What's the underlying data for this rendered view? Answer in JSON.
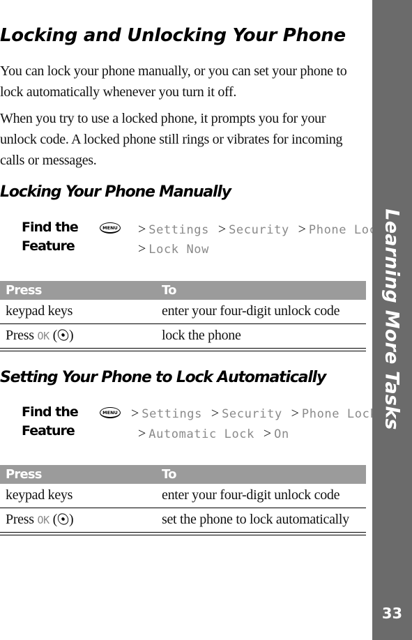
{
  "sidebar": {
    "section_title": "Learning More Tasks",
    "page_number": "33"
  },
  "main": {
    "title": "Locking and Unlocking Your Phone",
    "intro_paragraphs": [
      "You can lock your phone manually, or you can set your phone to lock automatically whenever you turn it off.",
      "When you try to use a locked phone, it prompts you for your unlock code. A locked phone still rings or vibrates for incoming calls or messages."
    ],
    "sections": [
      {
        "heading": "Locking Your Phone Manually",
        "find_feature": {
          "label_line1": "Find the",
          "label_line2": "Feature",
          "menu_icon": "menu-key-icon",
          "menu_icon_text": "MENU",
          "separator": ">",
          "path": [
            "Settings",
            "Security",
            "Phone Lock",
            "Lock Now"
          ]
        },
        "table": {
          "headers": [
            "Press",
            "To"
          ],
          "rows": [
            {
              "press": "keypad keys",
              "to": "enter your four-digit unlock code"
            },
            {
              "press_prefix": "Press",
              "press_key": "OK",
              "press_icon": "nav-key-icon",
              "to": "lock the phone"
            }
          ]
        }
      },
      {
        "heading": "Setting Your Phone to Lock Automatically",
        "find_feature": {
          "label_line1": "Find the",
          "label_line2": "Feature",
          "menu_icon": "menu-key-icon",
          "menu_icon_text": "MENU",
          "separator": ">",
          "path": [
            "Settings",
            "Security",
            "Phone Lock",
            "Automatic Lock",
            "On"
          ]
        },
        "table": {
          "headers": [
            "Press",
            "To"
          ],
          "rows": [
            {
              "press": "keypad keys",
              "to": "enter your four-digit unlock code"
            },
            {
              "press_prefix": "Press",
              "press_key": "OK",
              "press_icon": "nav-key-icon",
              "to": "set the phone to lock automatically"
            }
          ]
        }
      }
    ]
  },
  "colors": {
    "sidebar_bg": "#6b6b6b",
    "table_header_bg": "#9b9b9b",
    "menu_path_text": "#8a8a8a"
  }
}
